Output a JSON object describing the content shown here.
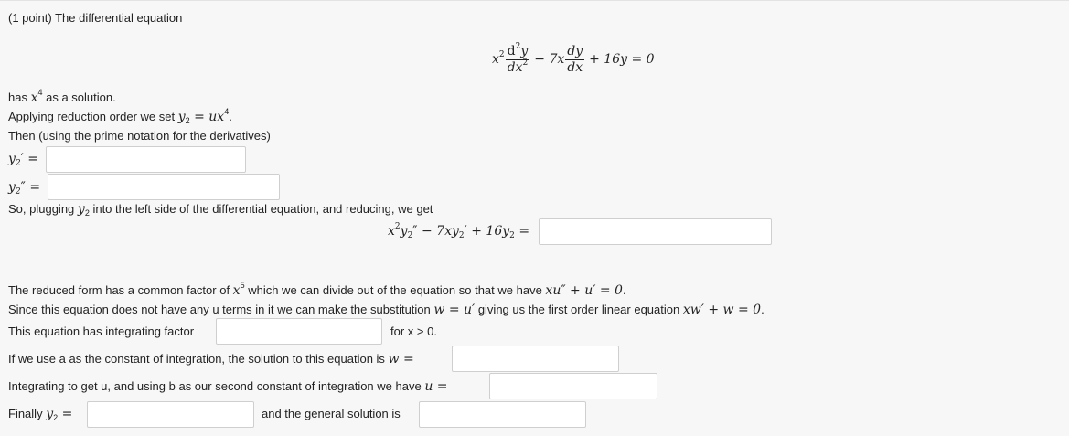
{
  "header": {
    "points": "(1 point)",
    "intro": "The differential equation"
  },
  "equation": {
    "x2": "x",
    "x2_exp": "2",
    "frac1_num": "d",
    "frac1_num_exp": "2",
    "frac1_num_var": "y",
    "frac1_den": "dx",
    "frac1_den_exp": "2",
    "minus_7x": "− 7x",
    "frac2_num": "dy",
    "frac2_den": "dx",
    "tail": "+ 16y = 0"
  },
  "lines": {
    "has_pre": "has ",
    "has_x": "x",
    "has_exp": "4",
    "has_post": " as a solution.",
    "applying_pre": "Applying reduction order we set ",
    "applying_y": "y",
    "applying_sub": "2",
    "applying_eq": " = ux",
    "applying_exp": "4",
    "applying_end": ".",
    "then": "Then (using the prime notation for the derivatives)",
    "y2p_label": "y",
    "y2p_sub": "2",
    "y2p_rest": "′ =",
    "y2pp_label": "y",
    "y2pp_sub": "2",
    "y2pp_rest": "″ =",
    "plugging_pre": "So, plugging ",
    "plugging_y": "y",
    "plugging_sub": "2",
    "plugging_post": " into the left side of the differential equation, and reducing, we get",
    "reduced_pre": "The reduced form has a common factor of ",
    "reduced_x": "x",
    "reduced_exp": "5",
    "reduced_mid": " which we can divide out of the equation so that we have ",
    "reduced_math": "xu″ + u′ = 0",
    "reduced_end": ".",
    "since_pre": "Since this equation does not have any u terms in it we can make the substitution ",
    "since_math1": "w = u′",
    "since_mid": " giving us the first order linear equation ",
    "since_math2": "xw′ + w = 0",
    "since_end": ".",
    "integrating_factor": "This equation has integrating factor",
    "for_x": "for x > 0.",
    "constant_pre": "If we use a as the constant of integration, the solution to this equation is ",
    "constant_math": "w =",
    "integrate_pre": "Integrating to get u, and using b as our second constant of integration we have ",
    "integrate_math": "u =",
    "finally_pre": "Finally ",
    "finally_y": "y",
    "finally_sub": "2",
    "finally_eq": " =",
    "general": "and the general solution is"
  },
  "centered_eq": {
    "x": "x",
    "x_exp": "2",
    "y1": "y",
    "y1_sub": "2",
    "y1_prime": "″",
    "minus": " − 7xy",
    "y2_sub": "2",
    "y2_prime": "′",
    "plus": " + 16y",
    "y3_sub": "2",
    "eq": " ="
  }
}
